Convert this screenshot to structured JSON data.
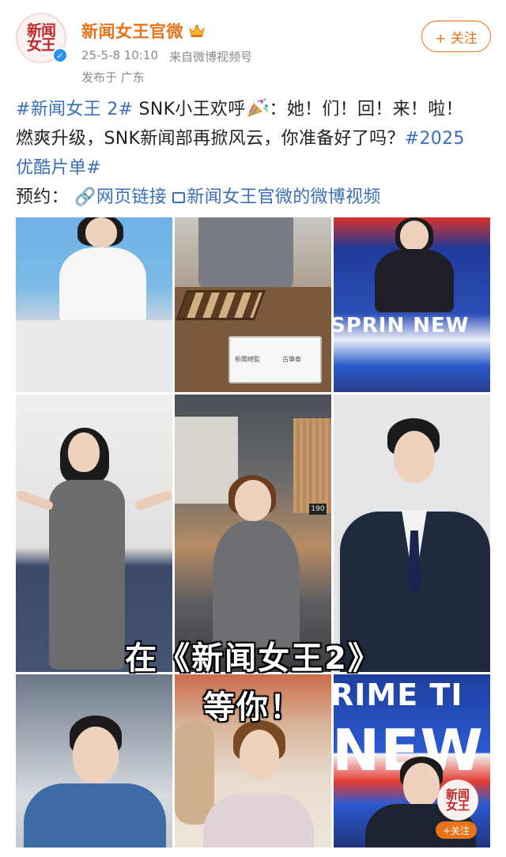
{
  "account": {
    "avatar_text": "新闻\n女王",
    "name": "新闻女王官微",
    "timestamp": "25-5-8 10:10",
    "source": "来自微博视频号",
    "location": "发布于 广东",
    "follow_label": "+ 关注",
    "verified_icon": "verified-badge-icon",
    "crown_icon": "crown-icon"
  },
  "post": {
    "topic1": "#新闻女王 2#",
    "line1_text": " SNK小王欢呼",
    "line1_tail": "：她！们！回！来！啦！",
    "line2_text": "燃爽升级，SNK新闻部再掀风云，你准备好了吗？",
    "topic2_a": "#2025",
    "topic2_b": "优酷片单#",
    "reserve_label": "预约：",
    "link1": "🔗网页链接",
    "link2": "新闻女王官微的微博视频"
  },
  "media": {
    "overlay_line1": "在《新闻女王2》",
    "overlay_line2": "等你！",
    "tv_text_top": "SPRIN NEW",
    "tv_text_bottom1": "RIME TI",
    "tv_text_bottom2": "NEW",
    "nameplate_left": "新聞總監",
    "nameplate_right": "古肇泰",
    "clock": "190",
    "watermark_text": "新闻\n女王",
    "watermark_follow": "+关注"
  },
  "colors": {
    "accent": "#e8741a",
    "link": "#3a6fb7",
    "meta": "#8a8a8a"
  }
}
